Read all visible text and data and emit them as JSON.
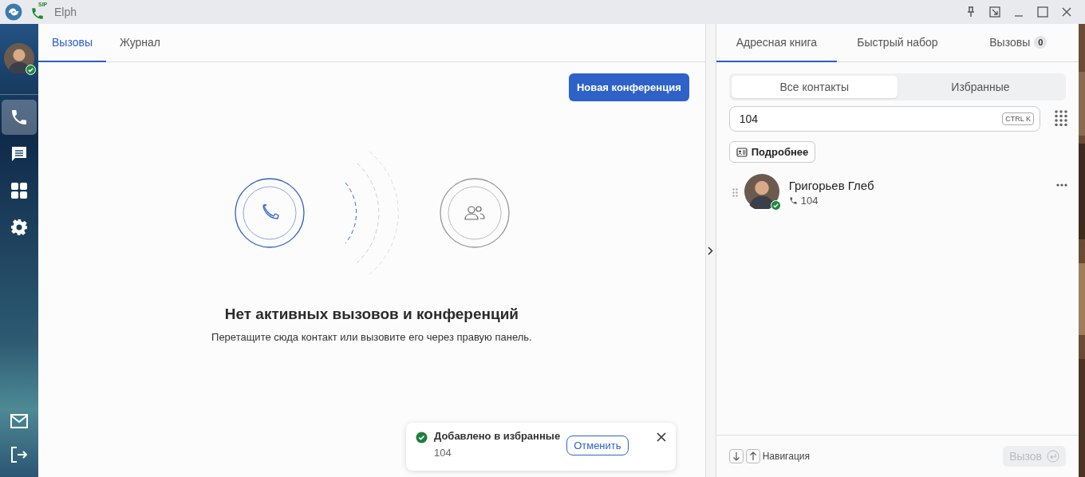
{
  "window": {
    "title": "Elph",
    "app_badge": "SIP"
  },
  "sidebar": {
    "items": [
      {
        "kind": "calls",
        "selected": true
      },
      {
        "kind": "chat",
        "selected": false
      },
      {
        "kind": "apps",
        "selected": false
      },
      {
        "kind": "settings",
        "selected": false
      }
    ],
    "bottom_items": [
      {
        "kind": "mail"
      },
      {
        "kind": "logout"
      }
    ]
  },
  "main_tabs": [
    {
      "label": "Вызовы",
      "selected": true
    },
    {
      "label": "Журнал",
      "selected": false
    }
  ],
  "new_conference_button": "Новая конференция",
  "empty_state": {
    "title": "Нет активных вызовов и конференций",
    "text": "Перетащите сюда контакт или вызовите его через правую панель."
  },
  "toast": {
    "title": "Добавлено в избранные",
    "subtitle": "104",
    "action": "Отменить"
  },
  "right_tabs": [
    {
      "label": "Адресная книга",
      "selected": true
    },
    {
      "label": "Быстрый набор",
      "selected": false
    },
    {
      "label": "Вызовы",
      "selected": false,
      "badge": "0"
    }
  ],
  "segments": [
    {
      "label": "Все контакты",
      "selected": true
    },
    {
      "label": "Избранные",
      "selected": false
    }
  ],
  "search": {
    "value": "104",
    "shortcut": "CTRL K"
  },
  "details_button": "Подробнее",
  "contacts": [
    {
      "name": "Григорьев Глеб",
      "number": "104"
    }
  ],
  "footer": {
    "nav_label": "Навигация",
    "call_button": {
      "label": "Вызов",
      "disabled": true
    }
  }
}
